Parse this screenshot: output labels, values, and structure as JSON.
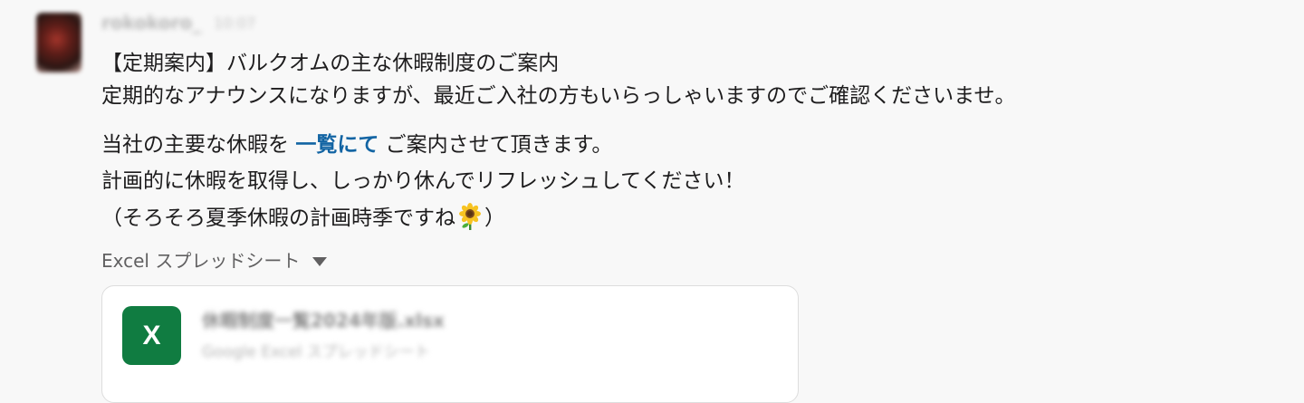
{
  "sender": {
    "name": "rokokoro_",
    "time": "10:07"
  },
  "message": {
    "line1": "【定期案内】バルクオムの主な休暇制度のご案内",
    "line2": "定期的なアナウンスになりますが、最近ご入社の方もいらっしゃいますのでご確認くださいませ。",
    "line3_before": "当社の主要な休暇を ",
    "line3_link": "一覧にて",
    "line3_after": " ご案内させて頂きます。",
    "line4": "計画的に休暇を取得し、しっかり休んでリフレッシュしてください！",
    "line5_before": "（そろそろ夏季休暇の計画時季ですね",
    "line5_emoji": "sunflower-icon",
    "line5_after": "）"
  },
  "attachment": {
    "type_label": "Excel スプレッドシート",
    "file_icon_letter": "X",
    "file_name": "休暇制度一覧2024年版.xlsx",
    "file_meta": "Google Excel スプレッドシート"
  },
  "colors": {
    "link": "#1264a3",
    "excel_green": "#107c41",
    "background": "#f8f8f8"
  }
}
